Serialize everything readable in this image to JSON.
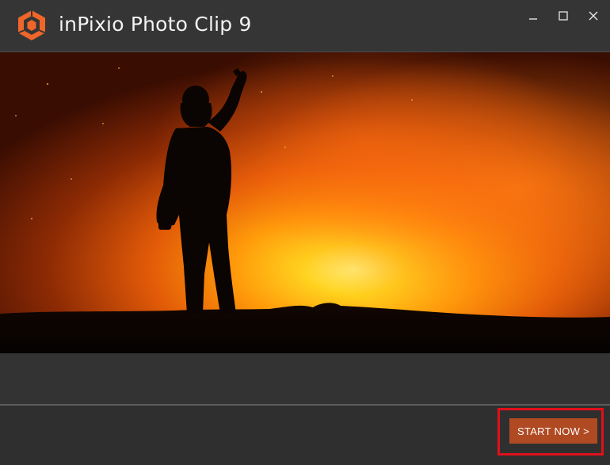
{
  "window": {
    "title": "inPixio Photo Clip 9",
    "logo_icon": "inpixio-logo-icon",
    "controls": {
      "minimize_icon": "minimize-icon",
      "maximize_icon": "maximize-icon",
      "close_icon": "close-icon"
    }
  },
  "hero": {
    "image_icon": "silhouette-person-fire-image"
  },
  "footer": {
    "start_label": "START NOW >"
  },
  "colors": {
    "titlebar": "#353535",
    "background": "#333333",
    "accent_button": "#b04a22",
    "highlight": "#e0101a",
    "logo_orange": "#f0662a"
  }
}
